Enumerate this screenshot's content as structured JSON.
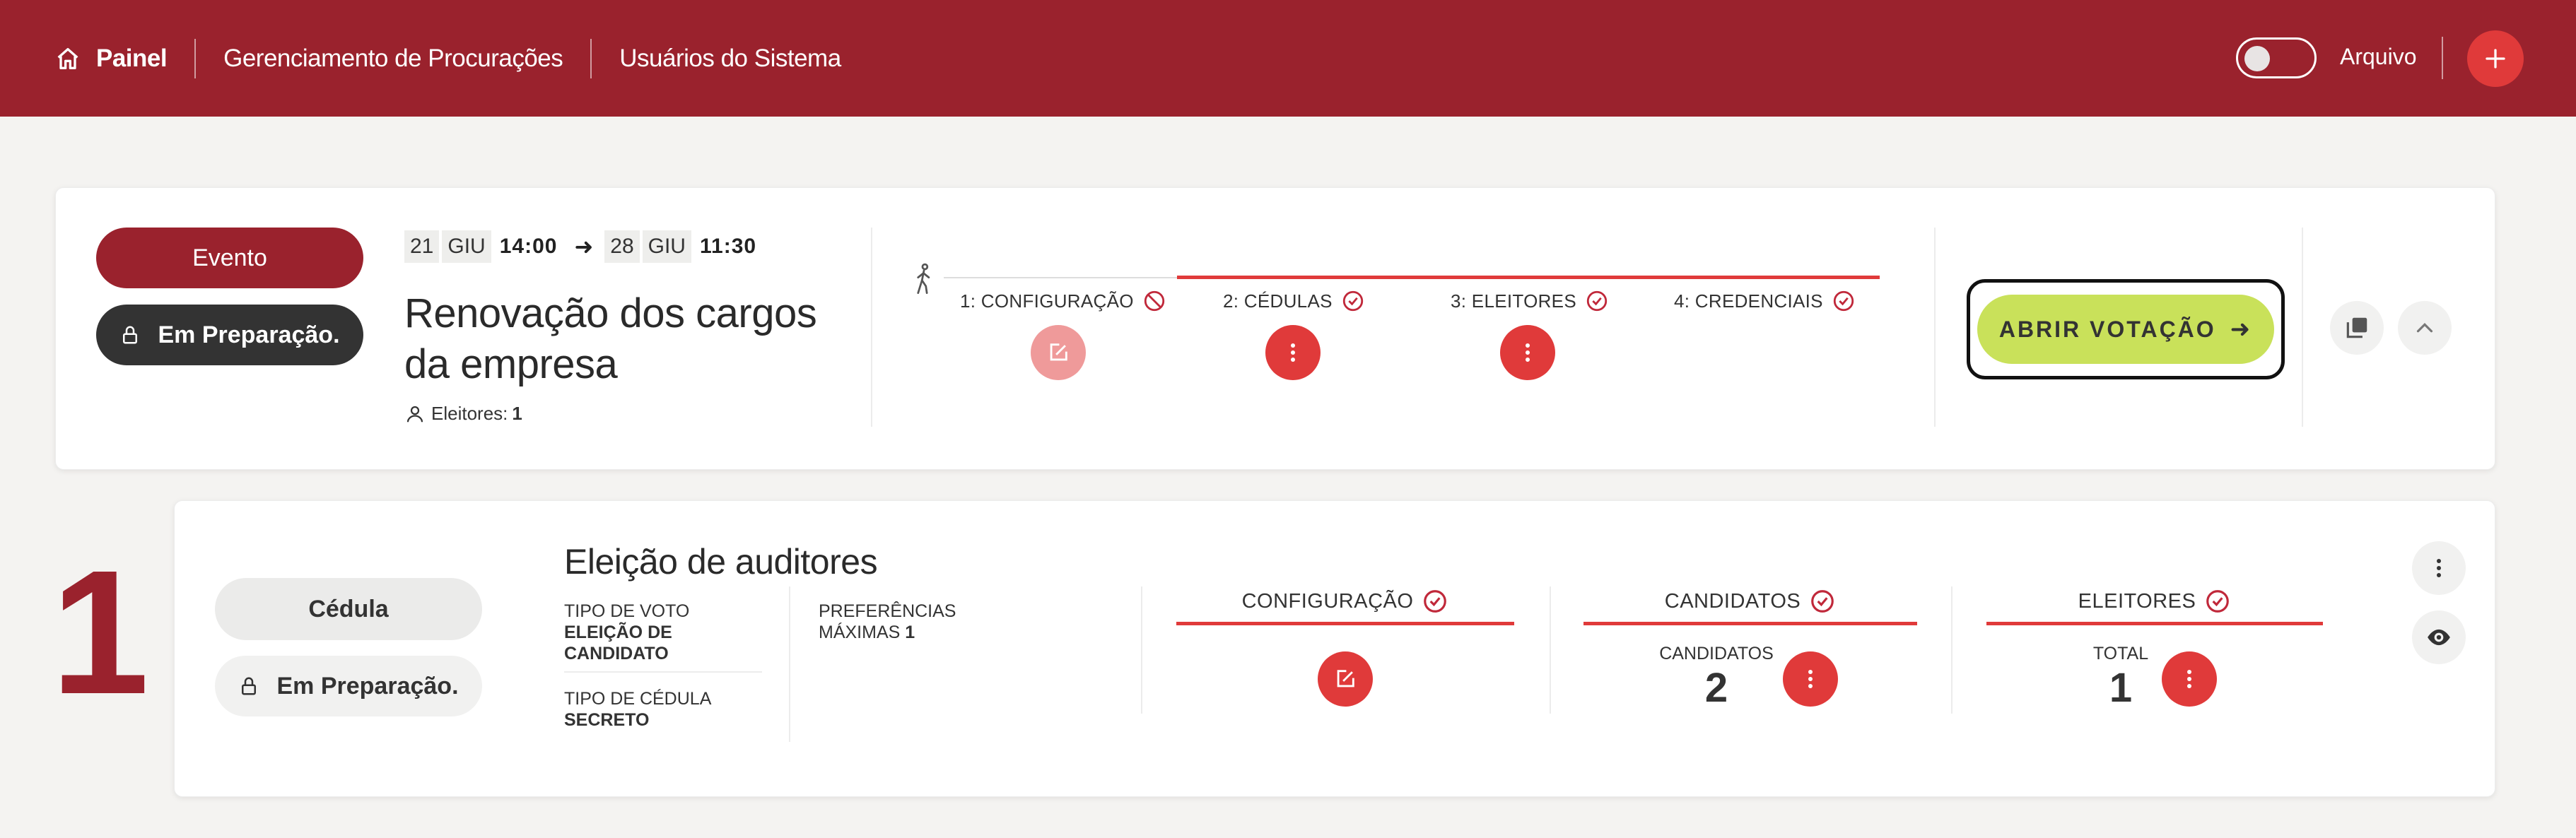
{
  "header": {
    "nav": [
      {
        "label": "Painel",
        "icon": "home-icon"
      },
      {
        "label": "Gerenciamento de Procurações"
      },
      {
        "label": "Usuários do Sistema"
      }
    ],
    "archive_label": "Arquivo",
    "archive_toggle_on": false,
    "add_icon": "plus-icon"
  },
  "event": {
    "type_label": "Evento",
    "status_label": "Em Preparação.",
    "start": {
      "day": "21",
      "month": "GIU",
      "time": "14:00"
    },
    "end": {
      "day": "28",
      "month": "GIU",
      "time": "11:30"
    },
    "title": "Renovação dos cargos da empresa",
    "voters_label": "Eleitores:",
    "voters_count": "1",
    "steps": [
      {
        "label": "1: CONFIGURAÇÃO",
        "status": "blocked"
      },
      {
        "label": "2: CÉDULAS",
        "status": "done"
      },
      {
        "label": "3: ELEITORES",
        "status": "done"
      },
      {
        "label": "4: CREDENCIAIS",
        "status": "done"
      }
    ],
    "open_button": "ABRIR VOTAÇÃO",
    "colors": {
      "brand": "#9a222d",
      "accent": "#e03a3a",
      "action": "#c9e15a"
    }
  },
  "ballot": {
    "number": "1",
    "type_label": "Cédula",
    "status_label": "Em Preparação.",
    "title": "Eleição de auditores",
    "vote_type_label": "TIPO DE VOTO",
    "vote_type_value": "ELEIÇÃO DE CANDIDATO",
    "ballot_type_label": "TIPO DE CÉDULA",
    "ballot_type_value": "SECRETO",
    "max_prefs_label": "PREFERÊNCIAS MÁXIMAS",
    "max_prefs_value": "1",
    "sections": {
      "config": {
        "label": "CONFIGURAÇÃO"
      },
      "candidates": {
        "label": "CANDIDATOS",
        "count_label": "CANDIDATOS",
        "count": "2"
      },
      "voters": {
        "label": "ELEITORES",
        "count_label": "TOTAL",
        "count": "1"
      }
    }
  }
}
